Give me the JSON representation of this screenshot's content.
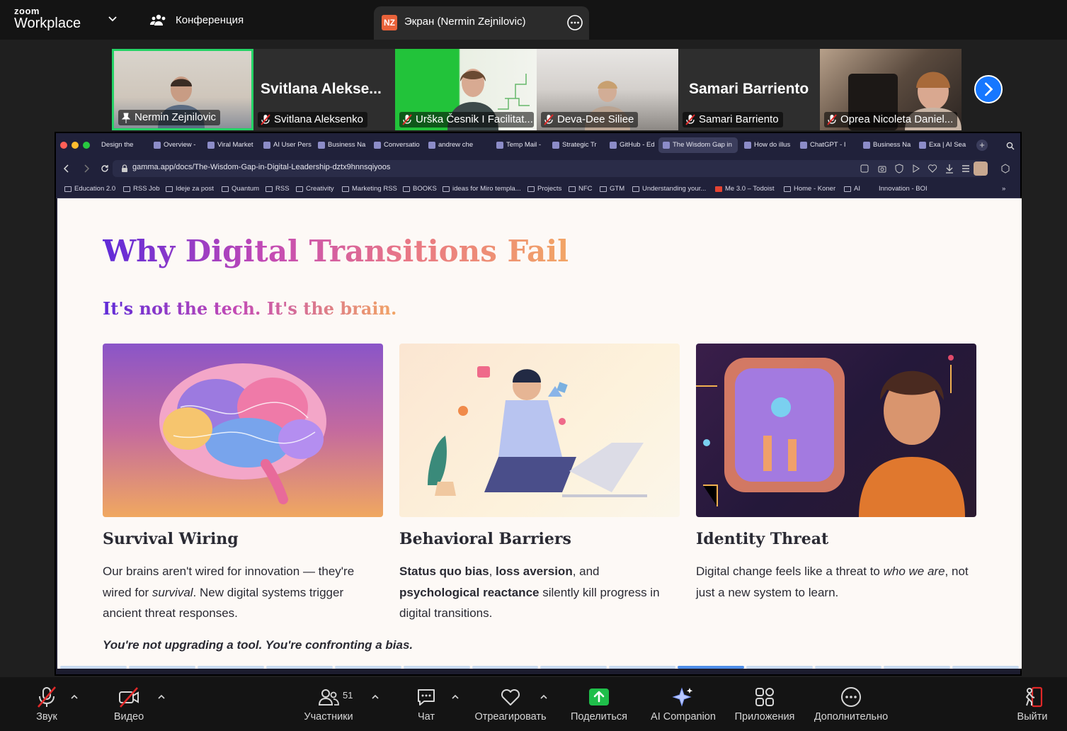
{
  "topbar": {
    "logo_line1": "zoom",
    "logo_line2": "Workplace",
    "conference_label": "Конференция",
    "share_initials": "NZ",
    "share_title": "Экран (Nermin Zejnilovic)"
  },
  "participants": [
    {
      "name": "Nermin Zejnilovic",
      "big": ""
    },
    {
      "name": "Svitlana Aleksenko",
      "big": "Svitlana  Alekse..."
    },
    {
      "name": "Urška Česnik I Facilitat...",
      "big": ""
    },
    {
      "name": "Deva-Dee Siliee",
      "big": ""
    },
    {
      "name": "Samari Barriento",
      "big": "Samari Barriento"
    },
    {
      "name": "Oprea Nicoleta Daniel...",
      "big": ""
    }
  ],
  "browser": {
    "tabs": [
      "Design the",
      "Overview -",
      "Viral Market",
      "AI User Pers",
      "Business Na",
      "Conversatio",
      "andrew che",
      "Temp Mail -",
      "Strategic Tr",
      "GitHub - Ed",
      "The Wisdom Gap in",
      "How do illus",
      "ChatGPT - I",
      "Business Na",
      "Exa | AI Sea"
    ],
    "new_tab": "+",
    "url": "gamma.app/docs/The-Wisdom-Gap-in-Digital-Leadership-dztx9hnnsqiyoos",
    "bookmarks": [
      "Education 2.0",
      "RSS Job",
      "Ideje za post",
      "Quantum",
      "RSS",
      "Creativity",
      "Marketing RSS",
      "BOOKS",
      "ideas for Miro templa...",
      "Projects",
      "NFC",
      "GTM",
      "Understanding your...",
      "Me 3.0 – Todoist",
      "Home - Koner",
      "AI",
      "Innovation - BOI"
    ],
    "more": "»"
  },
  "slide": {
    "title": "Why Digital Transitions Fail",
    "subtitle": "It's not the tech. It's the brain.",
    "cards": [
      {
        "title": "Survival Wiring",
        "t1": "Our brains aren't wired for innovation — they're wired for ",
        "em": "survival",
        "t2": ". New digital systems trigger ancient threat responses."
      },
      {
        "title": "Behavioral Barriers",
        "b1": "Status quo bias",
        "t1": ", ",
        "b2": "loss aversion",
        "t2": ", and ",
        "b3": "psychological reactance",
        "t3": " silently kill progress in digital transitions."
      },
      {
        "title": "Identity Threat",
        "t1": "Digital change feels like a threat to ",
        "em": "who we are",
        "t2": ", not just a new system to learn."
      }
    ],
    "footer": "You're not upgrading a tool. You're confronting a bias.",
    "progress_current": 10,
    "progress_total": 14
  },
  "toolbar": {
    "audio": "Звук",
    "video": "Видео",
    "participants": "Участники",
    "participants_count": "51",
    "chat": "Чат",
    "react": "Отреагировать",
    "share": "Поделиться",
    "ai": "AI Companion",
    "apps": "Приложения",
    "more": "Дополнительно",
    "leave": "Выйти"
  },
  "colors": {
    "share_green": "#25d366",
    "accent_blue": "#1677ff",
    "leave_red": "#e02828"
  }
}
